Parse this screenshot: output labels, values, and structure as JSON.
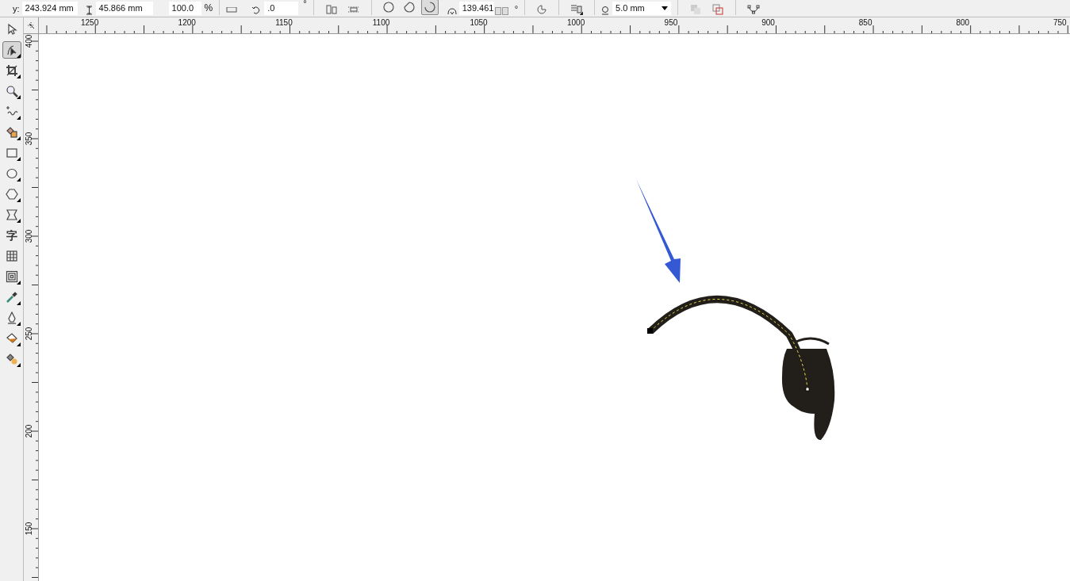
{
  "property_bar": {
    "y_label": "y:",
    "y_value": "243.924 mm",
    "height_value": "45.866 mm",
    "scale_value": "100.0",
    "scale_unit": "%",
    "rotation_value": ".0",
    "rotation_unit": "°",
    "corner_mode": [
      {
        "kind": "full",
        "selected": false
      },
      {
        "kind": "chord",
        "selected": false
      },
      {
        "kind": "arc",
        "selected": true
      }
    ],
    "angle_value": "139.461",
    "angle_unit": "°",
    "outline_width": "5.0 mm"
  },
  "horizontal_ruler": {
    "labels": [
      "1250",
      "1200",
      "1150",
      "1100",
      "1050",
      "1000",
      "950",
      "900",
      "850",
      "800",
      "750"
    ]
  },
  "vertical_ruler": {
    "labels": [
      "400",
      "350",
      "300",
      "250",
      "200",
      "150"
    ]
  },
  "toolbox": [
    {
      "kind": "pick",
      "selected": false
    },
    {
      "kind": "shape",
      "selected": true
    },
    {
      "kind": "crop",
      "selected": false
    },
    {
      "kind": "zoom",
      "selected": false
    },
    {
      "kind": "freehand",
      "selected": false
    },
    {
      "kind": "smart-fill",
      "selected": false
    },
    {
      "kind": "rectangle",
      "selected": false
    },
    {
      "kind": "ellipse",
      "selected": false
    },
    {
      "kind": "polygon",
      "selected": false
    },
    {
      "kind": "basic-shapes",
      "selected": false
    },
    {
      "kind": "text",
      "label": "字",
      "selected": false
    },
    {
      "kind": "table",
      "selected": false
    },
    {
      "kind": "contour",
      "selected": false
    },
    {
      "kind": "eyedropper",
      "selected": false
    },
    {
      "kind": "outline-pen",
      "selected": false
    },
    {
      "kind": "fill",
      "selected": false
    },
    {
      "kind": "interactive-fill",
      "selected": false
    }
  ]
}
